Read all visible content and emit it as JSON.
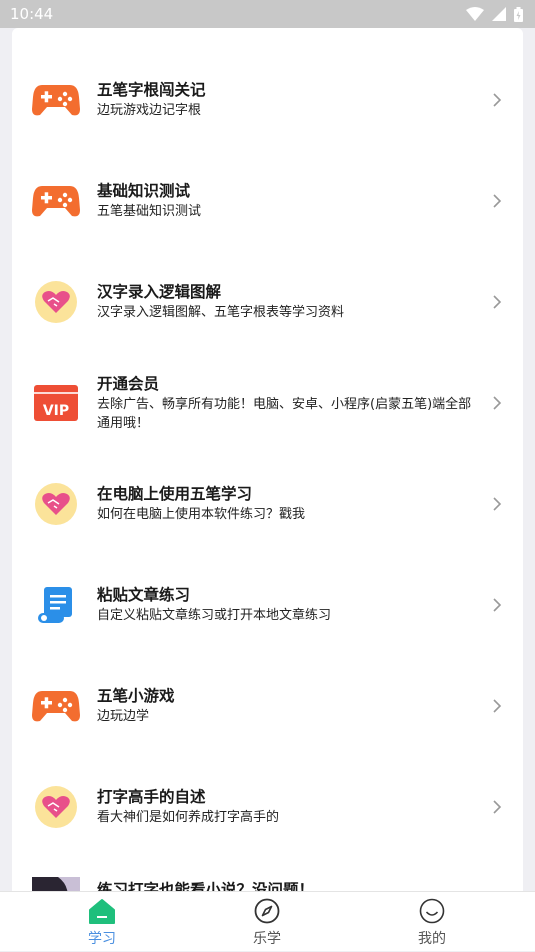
{
  "status_bar": {
    "time": "10:44"
  },
  "menu": [
    {
      "icon": "gamepad-icon",
      "title": "五笔字根闯关记",
      "subtitle": "边玩游戏边记字根"
    },
    {
      "icon": "gamepad-icon",
      "title": "基础知识测试",
      "subtitle": "五笔基础知识测试"
    },
    {
      "icon": "heart-handshake-icon",
      "title": "汉字录入逻辑图解",
      "subtitle": "汉字录入逻辑图解、五笔字根表等学习资料"
    },
    {
      "icon": "vip-ticket-icon",
      "title": "开通会员",
      "subtitle": "去除广告、畅享所有功能！电脑、安卓、小程序(启蒙五笔)端全部通用哦！"
    },
    {
      "icon": "heart-handshake-icon",
      "title": "在电脑上使用五笔学习",
      "subtitle": "如何在电脑上使用本软件练习？戳我"
    },
    {
      "icon": "scroll-icon",
      "title": "粘贴文章练习",
      "subtitle": "自定义粘贴文章练习或打开本地文章练习"
    },
    {
      "icon": "gamepad-icon",
      "title": "五笔小游戏",
      "subtitle": "边玩边学"
    },
    {
      "icon": "heart-handshake-icon",
      "title": "打字高手的自述",
      "subtitle": "看大神们是如何养成打字高手的"
    },
    {
      "icon": "photo-thumbnail",
      "title": "练习打字也能看小说？没问题！",
      "subtitle": ""
    }
  ],
  "vip_text": "VIP",
  "nav": [
    {
      "icon": "home-icon",
      "label": "学习",
      "active": true
    },
    {
      "icon": "compass-icon",
      "label": "乐学",
      "active": false
    },
    {
      "icon": "smile-icon",
      "label": "我的",
      "active": false
    }
  ],
  "colors": {
    "gamepad": "#f36d2f",
    "heart_bg": "#fbe39a",
    "heart": "#e8508a",
    "vip": "#ee4e35",
    "scroll": "#2b8fe8",
    "nav_active": "#4a8fe0",
    "home_icon": "#1fbf7c"
  }
}
